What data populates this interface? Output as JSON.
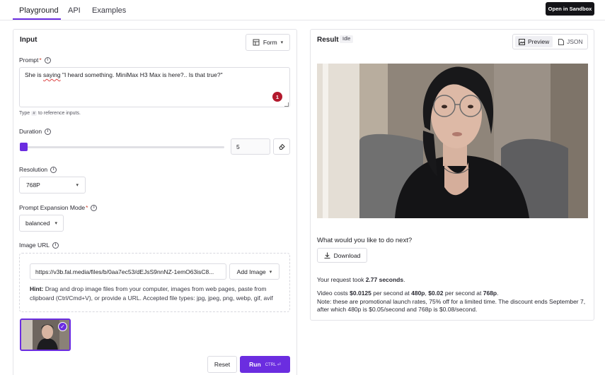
{
  "nav": {
    "tabs": [
      "Playground",
      "API",
      "Examples"
    ],
    "sandbox_label": "Open in Sandbox"
  },
  "input": {
    "title": "Input",
    "form_toggle": "Form",
    "prompt_label": "Prompt",
    "required_mark": "*",
    "prompt_pre": "She is ",
    "prompt_misspelled": "saying",
    "prompt_post": " \"I heard something. MiniMax H3 Max is here?.. Is that true?\"",
    "prompt_badge": "1",
    "reference_hint_pre": "Type",
    "reference_hint_key": "#",
    "reference_hint_post": "to reference inputs.",
    "duration_label": "Duration",
    "duration_value": "5",
    "duration_fraction": 0.0,
    "resolution_label": "Resolution",
    "resolution_value": "768P",
    "expansion_label": "Prompt Expansion Mode",
    "expansion_value": "balanced",
    "image_url_label": "Image URL",
    "image_url_value": "https://v3b.fal.media/files/b/0aa7ec53/dEJsS9nnNZ-1emO63isC8...",
    "add_image_label": "Add Image",
    "hint_bold": "Hint:",
    "hint_text": " Drag and drop image files from your computer, images from web pages, paste from clipboard (Ctrl/Cmd+V), or provide a URL. Accepted file types: jpg, jpeg, png, webp, gif, avif",
    "reset_label": "Reset",
    "run_label": "Run",
    "run_shortcut": "CTRL ⏎"
  },
  "result": {
    "title": "Result",
    "status": "Idle",
    "preview_label": "Preview",
    "json_label": "JSON",
    "next_question": "What would you like to do next?",
    "download_label": "Download",
    "took_pre": "Your request took ",
    "took_value": "2.77 seconds",
    "took_post": ".",
    "cost_pre": "Video costs ",
    "cost_480_price": "$0.0125",
    "cost_mid1": " per second at ",
    "cost_480": "480p",
    "cost_comma": ", ",
    "cost_768_price": "$0.02",
    "cost_mid2": " per second at ",
    "cost_768": "768p",
    "cost_end": ".",
    "note": "Note: these are promotional launch rates, 75% off for a limited time. The discount ends September 7, after which 480p is $0.05/second and 768p is $0.08/second."
  },
  "colors": {
    "accent": "#6b2de0",
    "badge": "#b3192d"
  }
}
